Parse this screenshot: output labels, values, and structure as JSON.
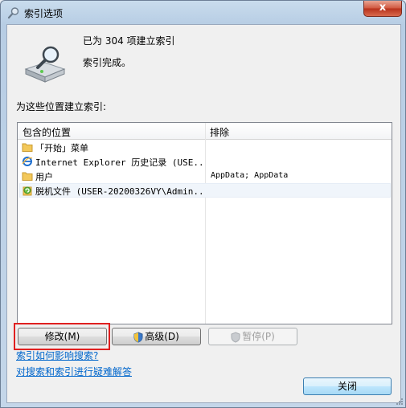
{
  "window": {
    "title": "索引选项",
    "close_glyph": "x"
  },
  "status": {
    "indexed_line": "已为 304 项建立索引",
    "complete_line": "索引完成。"
  },
  "section_label": "为这些位置建立索引:",
  "list": {
    "columns": {
      "included": "包含的位置",
      "excluded": "排除"
    },
    "rows": [
      {
        "icon": "folder-icon",
        "label": "「开始」菜单",
        "exclude": ""
      },
      {
        "icon": "internet-explorer-icon",
        "label": "Internet Explorer 历史记录 (USE...",
        "exclude": ""
      },
      {
        "icon": "folder-icon",
        "label": "用户",
        "exclude": "AppData; AppData"
      },
      {
        "icon": "offline-files-icon",
        "label": "脱机文件 (USER-20200326VY\\Admin...",
        "exclude": ""
      }
    ]
  },
  "buttons": {
    "modify": "修改(M)",
    "advanced": "高级(D)",
    "pause": "暂停(P)",
    "close": "关闭"
  },
  "links": {
    "how_index_affects": "索引如何影响搜索?",
    "troubleshoot": "对搜索和索引进行疑难解答"
  }
}
